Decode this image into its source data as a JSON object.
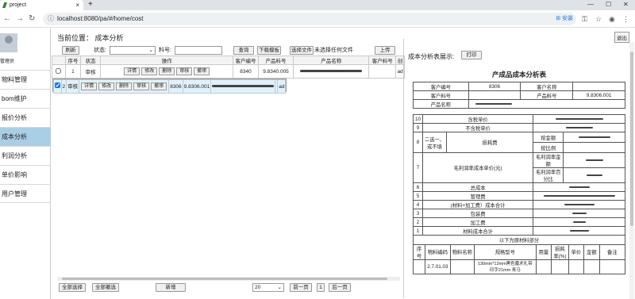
{
  "browser": {
    "tab_title": "project",
    "new_tab": "+",
    "url": "localhost:8080/pa/#/home/cost",
    "secure_label": "安装",
    "win_min": "—",
    "win_max": "☐",
    "win_close": "✕"
  },
  "sidebar": {
    "username": "管理员",
    "items": [
      {
        "label": "物料管理"
      },
      {
        "label": "bom维护"
      },
      {
        "label": "报价分析"
      },
      {
        "label": "成本分析"
      },
      {
        "label": "利润分析"
      },
      {
        "label": "单价影响"
      },
      {
        "label": "用户管理"
      }
    ]
  },
  "header": {
    "location": "当前位置： 成本分析",
    "logout": "退出"
  },
  "toolbar": {
    "refresh": "刷新",
    "status_label": "状态:",
    "material_label": "料号:",
    "query": "查询",
    "download": "下载模板",
    "choose_file": "选择文件",
    "no_file": "未选择任何文件",
    "upload": "上传"
  },
  "table": {
    "headers": [
      "序号",
      "状态",
      "操作",
      "客户编号",
      "产品料号",
      "产品名称",
      "客户料号",
      "创"
    ],
    "row_buttons": [
      "详情",
      "修改",
      "删除",
      "审核",
      "撤审"
    ],
    "rows": [
      {
        "no": "1",
        "status": "审核",
        "customer": "8340",
        "part": "9.8340.005",
        "extra": "ad"
      },
      {
        "no": "2",
        "status": "审核",
        "customer": "8306",
        "part": "9.8306.001",
        "extra": "ad"
      }
    ]
  },
  "footer": {
    "select_all": "全部选择",
    "deselect_all": "全部撤选",
    "add": "新增",
    "page_size": "20",
    "prev": "前一页",
    "page": "1",
    "next": "后一页"
  },
  "report": {
    "panel_label": "成本分析表展示:",
    "print": "打印",
    "title": "产成品成本分析表",
    "customer_no_label": "客户编号",
    "customer_no": "8306",
    "customer_name_label": "客户名称",
    "customer_part_label": "客户料号",
    "product_part_label": "产品料号",
    "product_part": "9.8306.001",
    "product_name_label": "产品名称",
    "rows": [
      {
        "no": "10",
        "label": "含税单价"
      },
      {
        "no": "9",
        "label": "不含税单价"
      },
      {
        "no": "8",
        "label": "二选一、或不填",
        "label2": "损耗费",
        "sub1": "按金额",
        "sub2": "按比例"
      },
      {
        "no": "7",
        "label": "毛利润率成本单价(元)",
        "sub1": "毛利润率金额",
        "sub2": "毛利润率百分比"
      },
      {
        "no": "6",
        "label": "总成本"
      },
      {
        "no": "5",
        "label": "管理费"
      },
      {
        "no": "4",
        "label": "(材料+加工费）成本合计"
      },
      {
        "no": "3",
        "label": "包装费"
      },
      {
        "no": "2",
        "label": "加工费"
      },
      {
        "no": "1",
        "label": "材料成本合计"
      }
    ],
    "raw_label": "以下为原材料部分",
    "raw_headers": [
      "序号",
      "物料编码",
      "物料名称",
      "规格型号",
      "用量",
      "损耗率(%)",
      "单价",
      "金额",
      "备注"
    ],
    "raw_row": {
      "code": "2.7.01.03",
      "spec": "130mm*12mm黑色魔术扎带 印字21mm 青马"
    }
  }
}
